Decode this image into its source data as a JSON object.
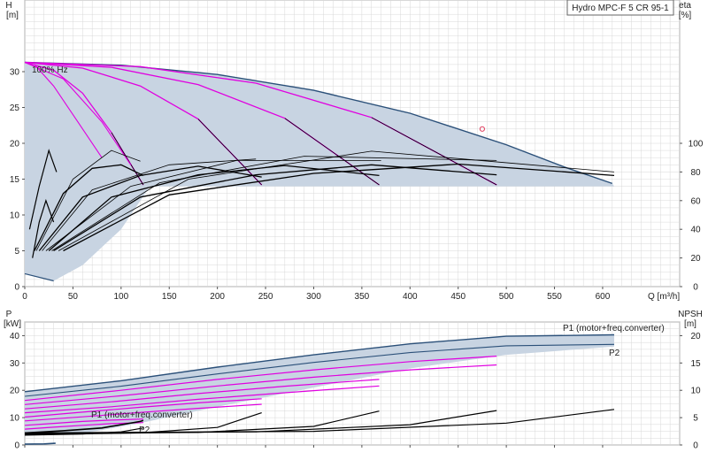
{
  "title": "Hydro MPC-F 5 CR 95-1",
  "colors": {
    "envelope_fill": "#c8d4e2",
    "envelope_stroke": "#2b5079",
    "pump_curve": "#e000e0",
    "efficiency_curve": "#000000",
    "system_point": "#e04060",
    "grid": "#d8d8d8",
    "p1_curve": "#2b5079"
  },
  "chart_data": [
    {
      "type": "line",
      "id": "head",
      "x_label": "Q [m³/h]",
      "y_label_left_symbol": "H",
      "y_label_left_unit": "[m]",
      "y_label_right_symbol": "eta",
      "y_label_right_unit": "[%]",
      "xlim": [
        0,
        680
      ],
      "ylim": [
        0,
        40
      ],
      "y2lim": [
        0,
        200
      ],
      "x_ticks": [
        0,
        50,
        100,
        150,
        200,
        250,
        300,
        350,
        400,
        450,
        500,
        550,
        600
      ],
      "y_ticks": [
        0,
        5,
        10,
        15,
        20,
        25,
        30
      ],
      "y2_ticks": [
        0,
        20,
        40,
        60,
        80,
        100
      ],
      "annotation": "100% Hz",
      "grid": true,
      "envelope": [
        [
          0,
          31.3
        ],
        [
          100,
          30.9
        ],
        [
          200,
          29.6
        ],
        [
          300,
          27.4
        ],
        [
          400,
          24.2
        ],
        [
          500,
          19.8
        ],
        [
          560,
          16.7
        ],
        [
          610,
          14.4
        ],
        [
          0,
          14
        ],
        [
          610,
          14
        ]
      ],
      "envelope_upper": [
        [
          0,
          31.3
        ],
        [
          100,
          30.9
        ],
        [
          200,
          29.6
        ],
        [
          300,
          27.4
        ],
        [
          400,
          24.2
        ],
        [
          500,
          19.8
        ],
        [
          560,
          16.7
        ],
        [
          610,
          14.4
        ]
      ],
      "envelope_min_head": 14,
      "envelope_low_x0": 0,
      "pump_curves": [
        [
          [
            0,
            31.3
          ],
          [
            30,
            30.2
          ],
          [
            60,
            27
          ],
          [
            90,
            21.5
          ],
          [
            123,
            14.2
          ]
        ],
        [
          [
            0,
            31.3
          ],
          [
            60,
            30.5
          ],
          [
            120,
            28
          ],
          [
            180,
            23.4
          ],
          [
            246,
            14.2
          ]
        ],
        [
          [
            0,
            31.3
          ],
          [
            90,
            30.6
          ],
          [
            180,
            28.2
          ],
          [
            270,
            23.5
          ],
          [
            368,
            14.2
          ]
        ],
        [
          [
            0,
            31.3
          ],
          [
            120,
            30.7
          ],
          [
            240,
            28.4
          ],
          [
            360,
            23.6
          ],
          [
            490,
            14.2
          ]
        ]
      ],
      "pump_curves_low": [
        [
          [
            0,
            31.3
          ],
          [
            40,
            29
          ],
          [
            80,
            23
          ],
          [
            110,
            17
          ]
        ],
        [
          [
            10,
            31
          ],
          [
            30,
            28
          ],
          [
            55,
            23
          ],
          [
            80,
            18
          ]
        ]
      ],
      "eff_curves": [
        [
          [
            10,
            5
          ],
          [
            40,
            13
          ],
          [
            70,
            16.5
          ],
          [
            100,
            17
          ],
          [
            123,
            15.5
          ]
        ],
        [
          [
            15,
            5
          ],
          [
            60,
            12.5
          ],
          [
            120,
            15.5
          ],
          [
            180,
            16.8
          ],
          [
            246,
            15.3
          ]
        ],
        [
          [
            25,
            5
          ],
          [
            90,
            12.5
          ],
          [
            180,
            15.6
          ],
          [
            270,
            16.9
          ],
          [
            368,
            15.5
          ]
        ],
        [
          [
            30,
            5
          ],
          [
            120,
            12.5
          ],
          [
            240,
            15.6
          ],
          [
            360,
            17
          ],
          [
            490,
            15.6
          ]
        ],
        [
          [
            40,
            5
          ],
          [
            150,
            12.8
          ],
          [
            300,
            15.8
          ],
          [
            450,
            17.1
          ],
          [
            612,
            15.5
          ]
        ],
        [
          [
            12,
            5
          ],
          [
            50,
            15
          ],
          [
            90,
            19
          ],
          [
            120,
            17.5
          ]
        ],
        [
          [
            18,
            5
          ],
          [
            70,
            13.5
          ],
          [
            150,
            17
          ],
          [
            240,
            17.8
          ]
        ],
        [
          [
            22,
            5
          ],
          [
            110,
            14
          ],
          [
            220,
            17.6
          ],
          [
            370,
            17.6
          ]
        ],
        [
          [
            28,
            5
          ],
          [
            140,
            14.5
          ],
          [
            290,
            18.2
          ],
          [
            490,
            17.6
          ]
        ],
        [
          [
            35,
            5
          ],
          [
            170,
            15
          ],
          [
            360,
            18.9
          ],
          [
            612,
            16
          ]
        ]
      ],
      "small_eff": [
        [
          [
            5,
            8
          ],
          [
            15,
            14
          ],
          [
            25,
            19
          ],
          [
            33,
            16
          ]
        ],
        [
          [
            8,
            4
          ],
          [
            15,
            9
          ],
          [
            22,
            12
          ],
          [
            30,
            9
          ]
        ]
      ],
      "operating_point": [
        475,
        22
      ]
    },
    {
      "type": "line",
      "id": "power",
      "y_label_left_symbol": "P",
      "y_label_left_unit": "[kW]",
      "y_label_right_symbol": "NPSH",
      "y_label_right_unit": "[m]",
      "xlim": [
        0,
        680
      ],
      "ylim": [
        0,
        45
      ],
      "y2lim": [
        0,
        22.5
      ],
      "y_ticks": [
        0,
        10,
        20,
        30,
        40
      ],
      "y2_ticks": [
        0,
        5,
        10,
        15,
        20
      ],
      "legend_p1_right": "P1 (motor+freq.converter)",
      "legend_p2_right": "P2",
      "legend_p1_left": "P1 (motor+freq.converter)",
      "legend_p2_left": "P2",
      "envelope_upper": [
        [
          0,
          19.5
        ],
        [
          100,
          23.5
        ],
        [
          200,
          28.5
        ],
        [
          300,
          33
        ],
        [
          400,
          37
        ],
        [
          500,
          39.8
        ],
        [
          612,
          40.3
        ]
      ],
      "envelope_lower": [
        [
          0,
          3.6
        ],
        [
          60,
          4.2
        ],
        [
          120,
          8
        ],
        [
          200,
          14
        ],
        [
          300,
          21
        ],
        [
          400,
          28
        ],
        [
          500,
          33
        ],
        [
          612,
          36
        ]
      ],
      "p1_top": [
        [
          0,
          19.5
        ],
        [
          100,
          23.5
        ],
        [
          200,
          28.5
        ],
        [
          300,
          33
        ],
        [
          400,
          37
        ],
        [
          500,
          39.8
        ],
        [
          612,
          40.3
        ]
      ],
      "p2_top": [
        [
          0,
          17.8
        ],
        [
          100,
          21.5
        ],
        [
          200,
          26
        ],
        [
          300,
          30.2
        ],
        [
          400,
          33.8
        ],
        [
          500,
          36.3
        ],
        [
          612,
          36.8
        ]
      ],
      "pump_power": [
        [
          [
            0,
            16.3
          ],
          [
            100,
            20
          ],
          [
            200,
            24
          ],
          [
            300,
            27.5
          ],
          [
            400,
            30.5
          ],
          [
            490,
            32.5
          ]
        ],
        [
          [
            0,
            14.8
          ],
          [
            100,
            18
          ],
          [
            200,
            21.6
          ],
          [
            300,
            24.8
          ],
          [
            400,
            27.5
          ],
          [
            490,
            29.3
          ]
        ],
        [
          [
            0,
            13.2
          ],
          [
            90,
            15.8
          ],
          [
            180,
            18.8
          ],
          [
            270,
            21.5
          ],
          [
            368,
            24
          ]
        ],
        [
          [
            0,
            11.8
          ],
          [
            90,
            14
          ],
          [
            180,
            16.7
          ],
          [
            270,
            19.1
          ],
          [
            368,
            21.6
          ]
        ],
        [
          [
            0,
            10.2
          ],
          [
            60,
            12
          ],
          [
            120,
            13.8
          ],
          [
            180,
            15.4
          ],
          [
            246,
            16.9
          ]
        ],
        [
          [
            0,
            8.8
          ],
          [
            60,
            10.3
          ],
          [
            120,
            11.9
          ],
          [
            180,
            13.4
          ],
          [
            246,
            14.9
          ]
        ],
        [
          [
            0,
            7.2
          ],
          [
            30,
            7.9
          ],
          [
            60,
            8.6
          ],
          [
            90,
            9.1
          ],
          [
            123,
            9.5
          ]
        ],
        [
          [
            0,
            5.8
          ],
          [
            30,
            6.5
          ],
          [
            60,
            7.2
          ],
          [
            90,
            7.8
          ],
          [
            123,
            8.2
          ]
        ]
      ],
      "npsh": [
        [
          [
            0,
            1.8
          ],
          [
            60,
            2.0
          ],
          [
            100,
            2.4
          ],
          [
            123,
            3.1
          ]
        ],
        [
          [
            0,
            1.9
          ],
          [
            120,
            2.2
          ],
          [
            200,
            3.2
          ],
          [
            246,
            5.9
          ]
        ],
        [
          [
            0,
            2.0
          ],
          [
            180,
            2.3
          ],
          [
            300,
            3.4
          ],
          [
            368,
            6.2
          ]
        ],
        [
          [
            0,
            2.1
          ],
          [
            240,
            2.4
          ],
          [
            400,
            3.7
          ],
          [
            490,
            6.3
          ]
        ],
        [
          [
            0,
            2.2
          ],
          [
            300,
            2.5
          ],
          [
            500,
            4.0
          ],
          [
            612,
            6.5
          ]
        ]
      ],
      "npsh_low": [
        [
          0,
          2.2
        ],
        [
          40,
          2.6
        ],
        [
          80,
          3.1
        ],
        [
          120,
          4.3
        ],
        [
          123,
          4.5
        ]
      ],
      "p2_small": [
        [
          0,
          0.3
        ],
        [
          20,
          0.4
        ],
        [
          32,
          0.6
        ]
      ]
    }
  ]
}
